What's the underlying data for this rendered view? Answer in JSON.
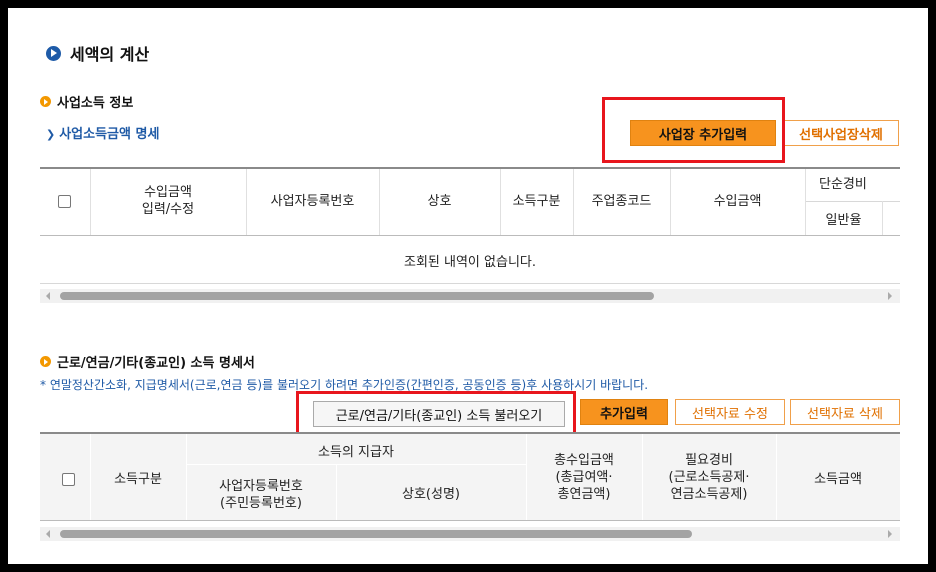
{
  "tax_calc": {
    "title": "세액의 계산"
  },
  "business": {
    "title": "사업소득 정보",
    "detail_link": "사업소득금액 명세",
    "add_button": "사업장 추가입력",
    "delete_button": "선택사업장삭제",
    "columns": {
      "income_input": "수입금액\n입력/수정",
      "biz_reg_no": "사업자등록번호",
      "trade_name": "상호",
      "income_type": "소득구분",
      "main_code": "주업종코드",
      "revenue": "수입금액",
      "simple_expense": "단순경비",
      "general_rate": "일반율"
    },
    "empty_message": "조회된 내역이 없습니다."
  },
  "labor": {
    "title": "근로/연금/기타(종교인) 소득 명세서",
    "notice": "* 연말정산간소화, 지급명세서(근로,연금 등)를 불러오기 하려면 추가인증(간편인증, 공동인증 등)후 사용하시기 바랍니다.",
    "load_button": "근로/연금/기타(종교인) 소득 불러오기",
    "add_button": "추가입력",
    "edit_button": "선택자료 수정",
    "delete_button": "선택자료 삭제",
    "columns": {
      "income_type": "소득구분",
      "payer": "소득의 지급자",
      "payer_reg_no": "사업자등록번호\n(주민등록번호)",
      "payer_name": "상호(성명)",
      "total_income": "총수입금액\n(총급여액·\n총연금액)",
      "necessary_expense": "필요경비\n(근로소득공제·\n연금소득공제)",
      "income_amount": "소득금액"
    }
  },
  "colors": {
    "accent_orange": "#f7931e",
    "highlight_red": "#e8161d",
    "link_blue": "#1f5aa6"
  }
}
